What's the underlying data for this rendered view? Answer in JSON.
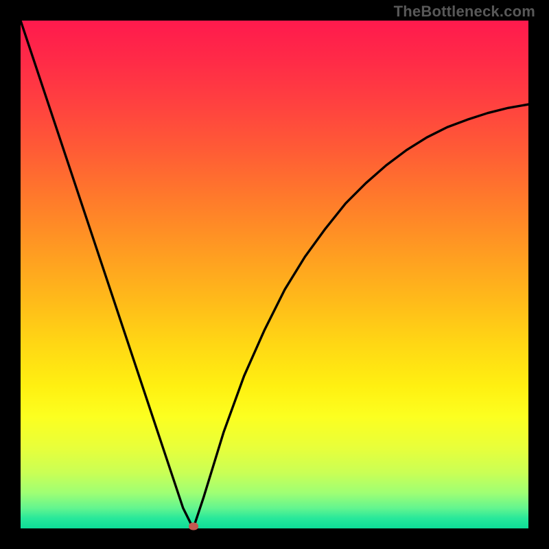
{
  "watermark": "TheBottleneck.com",
  "chart_data": {
    "type": "line",
    "title": "",
    "xlabel": "",
    "ylabel": "",
    "xlim": [
      0,
      1
    ],
    "ylim": [
      0,
      1
    ],
    "series": [
      {
        "name": "curve",
        "x": [
          0.0,
          0.03,
          0.06,
          0.09,
          0.12,
          0.15,
          0.18,
          0.21,
          0.24,
          0.27,
          0.3,
          0.32,
          0.34,
          0.36,
          0.4,
          0.44,
          0.48,
          0.52,
          0.56,
          0.6,
          0.64,
          0.68,
          0.72,
          0.76,
          0.8,
          0.84,
          0.88,
          0.92,
          0.96,
          1.0
        ],
        "y": [
          1.0,
          0.91,
          0.82,
          0.73,
          0.64,
          0.55,
          0.46,
          0.37,
          0.28,
          0.19,
          0.1,
          0.04,
          0.0,
          0.06,
          0.19,
          0.3,
          0.39,
          0.47,
          0.535,
          0.59,
          0.64,
          0.68,
          0.715,
          0.745,
          0.77,
          0.79,
          0.805,
          0.818,
          0.828,
          0.835
        ]
      }
    ],
    "minimum": {
      "x": 0.34,
      "y": 0.0
    },
    "gradient_stops": [
      {
        "pos": 0.0,
        "color": "#ff1a4d"
      },
      {
        "pos": 0.5,
        "color": "#ffba1a"
      },
      {
        "pos": 0.8,
        "color": "#fcff20"
      },
      {
        "pos": 1.0,
        "color": "#0ddc98"
      }
    ],
    "marker_color": "#c25a51"
  }
}
